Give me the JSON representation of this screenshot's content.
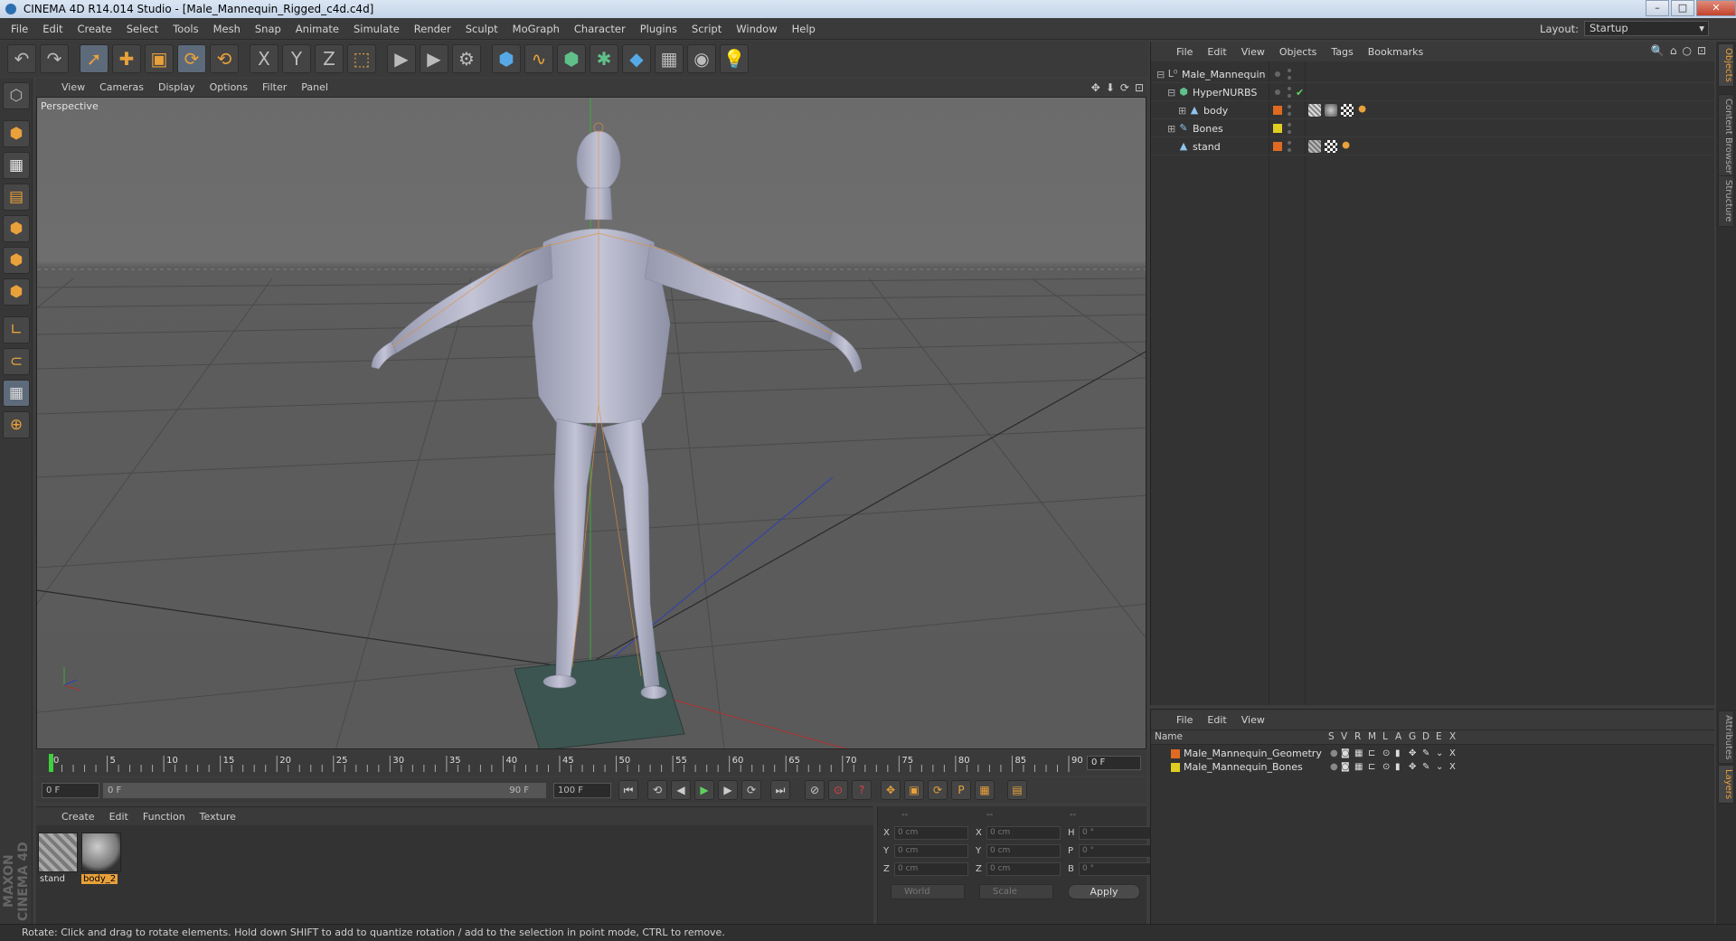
{
  "window": {
    "title": "CINEMA 4D R14.014 Studio - [Male_Mannequin_Rigged_c4d.c4d]"
  },
  "menubar": [
    "File",
    "Edit",
    "Create",
    "Select",
    "Tools",
    "Mesh",
    "Snap",
    "Animate",
    "Simulate",
    "Render",
    "Sculpt",
    "MoGraph",
    "Character",
    "Plugins",
    "Script",
    "Window",
    "Help"
  ],
  "layout": {
    "label": "Layout:",
    "value": "Startup"
  },
  "toolbar": {
    "icons": [
      "undo-icon",
      "redo-icon",
      "live-selection-icon",
      "move-icon",
      "scale-icon",
      "rotate-icon",
      "recent-tool-icon",
      "x-axis-lock-icon",
      "y-axis-lock-icon",
      "z-axis-lock-icon",
      "world-coordinates-icon",
      "render-view-icon",
      "render-picture-viewer-icon",
      "render-settings-icon",
      "cube-object-icon",
      "spline-pen-icon",
      "nurbs-icon",
      "array-icon",
      "deformer-icon",
      "scene-floor-icon",
      "camera-icon",
      "light-icon"
    ],
    "glyphs": [
      "↶",
      "↷",
      "➚",
      "✚",
      "▣",
      "⟳",
      "⟲",
      "X",
      "Y",
      "Z",
      "⬚",
      "▶",
      "▶",
      "⚙",
      "⬢",
      "∿",
      "⬢",
      "✱",
      "◆",
      "▦",
      "◉",
      "💡"
    ]
  },
  "left_tools": {
    "icons": [
      "make-editable-icon",
      "model-mode-icon",
      "texture-mode-icon",
      "workplane-icon",
      "points-mode-icon",
      "edges-mode-icon",
      "polygons-mode-icon",
      "axis-mode-icon",
      "magnet-icon",
      "snap-grid-icon",
      "locked-workplane-icon"
    ],
    "glyphs": [
      "⬡",
      "⬢",
      "▦",
      "▤",
      "⬢",
      "⬢",
      "⬢",
      "∟",
      "⊂",
      "▦",
      "⊕"
    ]
  },
  "branding": "MAXON CINEMA 4D",
  "viewport": {
    "menu": [
      "View",
      "Cameras",
      "Display",
      "Options",
      "Filter",
      "Panel"
    ],
    "label": "Perspective",
    "nav": [
      "✥",
      "⬇",
      "⟳",
      "⊡"
    ]
  },
  "timeline": {
    "ticks": [
      "0",
      "5",
      "10",
      "15",
      "20",
      "25",
      "30",
      "35",
      "40",
      "45",
      "50",
      "55",
      "60",
      "65",
      "70",
      "75",
      "80",
      "85",
      "90"
    ],
    "current_frame": "0 F"
  },
  "transport": {
    "start": "0 F",
    "range_start": "0 F",
    "range_end": "90 F",
    "end": "100 F",
    "buttons": [
      "⏮",
      "⟲",
      "◀",
      "▶",
      "▶",
      "⟳",
      "⏭"
    ],
    "key_buttons": [
      "⊘",
      "⊙",
      "?",
      "✥",
      "▣",
      "⟳",
      "P",
      "▦",
      "▤"
    ]
  },
  "material_manager": {
    "menu": [
      "Create",
      "Edit",
      "Function",
      "Texture"
    ],
    "materials": [
      {
        "name": "stand"
      },
      {
        "name": "body_2"
      }
    ]
  },
  "coordinates": {
    "headers": [
      "--",
      "--",
      "--"
    ],
    "rows": [
      {
        "a": "X",
        "v1": "0 cm",
        "b": "X",
        "v2": "0 cm",
        "c": "H",
        "v3": "0 °"
      },
      {
        "a": "Y",
        "v1": "0 cm",
        "b": "Y",
        "v2": "0 cm",
        "c": "P",
        "v3": "0 °"
      },
      {
        "a": "Z",
        "v1": "0 cm",
        "b": "Z",
        "v2": "0 cm",
        "c": "B",
        "v3": "0 °"
      }
    ],
    "mode": "World",
    "type": "Scale",
    "apply": "Apply"
  },
  "object_manager": {
    "menu": [
      "File",
      "Edit",
      "View",
      "Objects",
      "Tags",
      "Bookmarks"
    ],
    "icons": [
      "🔍",
      "⌂",
      "○",
      "⊡"
    ],
    "objects": [
      {
        "name": "Male_Mannequin",
        "icon": "null-icon",
        "glyph": "L⁰",
        "color": "#bbbbbb"
      },
      {
        "name": "HyperNURBS",
        "icon": "hypernurbs-icon",
        "glyph": "⬢",
        "color": "#5fc08a"
      },
      {
        "name": "body",
        "icon": "polygon-object-icon",
        "glyph": "▲",
        "color": "#8ec4ee"
      },
      {
        "name": "Bones",
        "icon": "bone-icon",
        "glyph": "✎",
        "color": "#8ec4ee"
      },
      {
        "name": "stand",
        "icon": "polygon-object-icon",
        "glyph": "▲",
        "color": "#8ec4ee"
      }
    ],
    "check": "✔"
  },
  "layer_manager": {
    "menu": [
      "File",
      "Edit",
      "View"
    ],
    "columns": [
      "Name",
      "S",
      "V",
      "R",
      "M",
      "L",
      "A",
      "G",
      "D",
      "E",
      "X"
    ],
    "layers": [
      {
        "name": "Male_Mannequin_Geometry",
        "color": "#e06a22"
      },
      {
        "name": "Male_Mannequin_Bones",
        "color": "#e0cf22"
      }
    ]
  },
  "right_tabs": [
    "Objects",
    "Content Browser",
    "Structure",
    "Attributes",
    "Layers"
  ],
  "status": "Rotate: Click and drag to rotate elements. Hold down SHIFT to add to quantize rotation / add to the selection in point mode, CTRL to remove."
}
